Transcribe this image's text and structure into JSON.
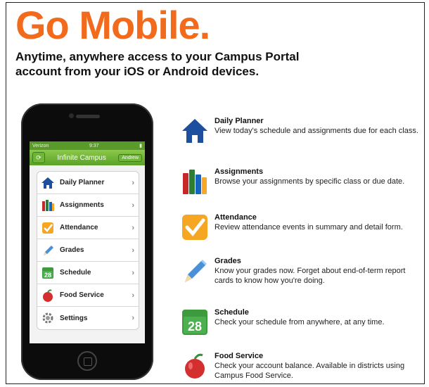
{
  "hero": {
    "title": "Go Mobile.",
    "subtitle": "Anytime, anywhere access to your Campus Portal account from your iOS or Android devices."
  },
  "phone": {
    "status_left": "Verizon",
    "status_time": "9:37",
    "app_title": "Infinite Campus",
    "user_button": "Andrew",
    "menu": [
      {
        "label": "Daily Planner",
        "icon": "house-icon"
      },
      {
        "label": "Assignments",
        "icon": "books-icon"
      },
      {
        "label": "Attendance",
        "icon": "checkmark-icon"
      },
      {
        "label": "Grades",
        "icon": "pencil-icon"
      },
      {
        "label": "Schedule",
        "icon": "calendar-icon",
        "icon_text": "28"
      },
      {
        "label": "Food Service",
        "icon": "apple-icon"
      },
      {
        "label": "Settings",
        "icon": "gear-icon"
      }
    ]
  },
  "features": [
    {
      "name": "Daily Planner",
      "desc": "View today's schedule and assignments due for each class.",
      "icon": "house-icon"
    },
    {
      "name": "Assignments",
      "desc": "Browse your assignments by specific class or due date.",
      "icon": "books-icon"
    },
    {
      "name": "Attendance",
      "desc": "Review attendance events in summary and detail form.",
      "icon": "checkmark-icon"
    },
    {
      "name": "Grades",
      "desc": "Know your grades now. Forget about end-of-term report cards to know how you're doing.",
      "icon": "pencil-icon"
    },
    {
      "name": "Schedule",
      "desc": "Check your schedule from anywhere, at any time.",
      "icon": "calendar-icon",
      "icon_text": "28"
    },
    {
      "name": "Food Service",
      "desc": "Check your account balance. Available in districts using Campus Food Service.",
      "icon": "apple-icon"
    }
  ],
  "colors": {
    "brand_orange": "#f26b1d",
    "app_green": "#6fb638"
  }
}
